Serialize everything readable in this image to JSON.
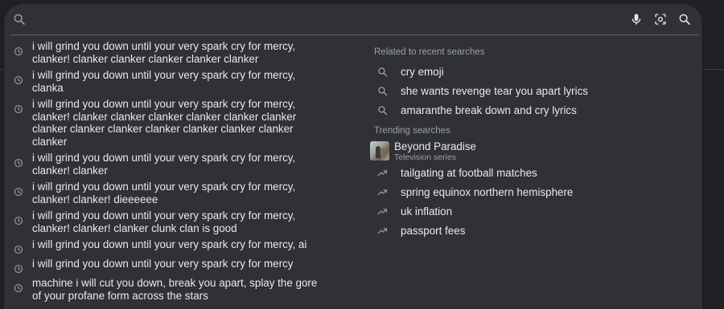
{
  "search": {
    "value": "",
    "placeholder": ""
  },
  "history": [
    "i will grind you down until your very spark cry for mercy, clanker! clanker clanker clanker clanker clanker",
    "i will grind you down until your very spark cry for mercy, clanka",
    "i will grind you down until your very spark cry for mercy, clanker! clanker clanker clanker clanker clanker clanker clanker clanker clanker clanker clanker clanker clanker clanker",
    "i will grind you down until your very spark cry for mercy, clanker! clanker",
    "i will grind you down until your very spark cry for mercy, clanker! clanker! dieeeeee",
    "i will grind you down until your very spark cry for mercy, clanker! clanker! clanker clunk clan is good",
    "i will grind you down until your very spark cry for mercy, ai",
    "i will grind you down until your very spark cry for mercy",
    "machine i will cut you down, break you apart, splay the gore of your profane form across the stars"
  ],
  "related": {
    "title": "Related to recent searches",
    "items": [
      "cry emoji",
      "she wants revenge tear you apart lyrics",
      "amaranthe break down and cry lyrics"
    ]
  },
  "trending": {
    "title": "Trending searches",
    "entity": {
      "title": "Beyond Paradise",
      "subtitle": "Television series"
    },
    "items": [
      "tailgating at football matches",
      "spring equinox northern hemisphere",
      "uk inflation",
      "passport fees"
    ]
  },
  "colors": {
    "panel": "#303134",
    "page": "#202124",
    "text": "#e8eaed",
    "muted": "#9aa0a6",
    "icon": "#9aa0a6"
  },
  "icons": {
    "search": "search-icon",
    "mic": "microphone-icon",
    "lens": "google-lens-icon",
    "history": "history-clock-icon",
    "trending": "trending-up-icon"
  }
}
